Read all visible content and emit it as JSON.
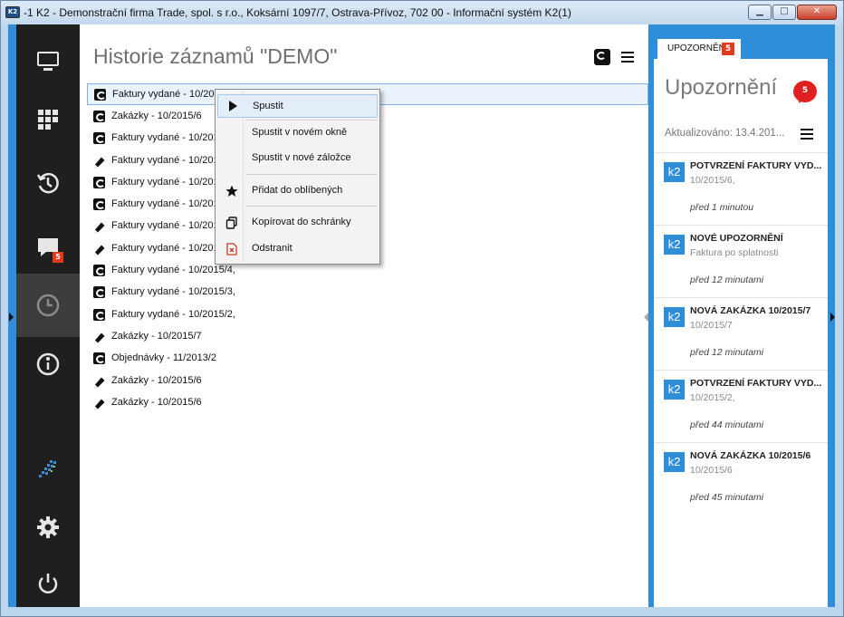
{
  "window": {
    "icon_text": "K2",
    "title": "-1 K2 - Demonstrační firma Trade, spol. s r.o., Koksární 1097/7, Ostrava-Přívoz, 702 00 - Informační systém K2(1)",
    "min_glyph": "▁",
    "max_glyph": "□",
    "close_glyph": "✕"
  },
  "rail": {
    "chat_badge": "5"
  },
  "main": {
    "title": "Historie záznamů \"DEMO\"",
    "history": [
      {
        "label": "Faktury vydané - 10/201",
        "icon": "doc-icon"
      },
      {
        "label": "Zakázky - 10/2015/6",
        "icon": "doc-icon"
      },
      {
        "label": "Faktury vydané - 10/201",
        "icon": "doc-icon"
      },
      {
        "label": "Faktury vydané - 10/201",
        "icon": "pencil-icon"
      },
      {
        "label": "Faktury vydané - 10/201",
        "icon": "doc-icon"
      },
      {
        "label": "Faktury vydané - 10/201",
        "icon": "doc-icon"
      },
      {
        "label": "Faktury vydané - 10/201",
        "icon": "pencil-icon"
      },
      {
        "label": "Faktury vydané - 10/201",
        "icon": "pencil-icon"
      },
      {
        "label": "Faktury vydané - 10/2015/4,",
        "icon": "doc-icon"
      },
      {
        "label": "Faktury vydané - 10/2015/3,",
        "icon": "doc-icon"
      },
      {
        "label": "Faktury vydané - 10/2015/2,",
        "icon": "doc-icon"
      },
      {
        "label": "Zakázky - 10/2015/7",
        "icon": "pencil-icon"
      },
      {
        "label": "Objednávky - 11/2013/2",
        "icon": "doc-icon"
      },
      {
        "label": "Zakázky - 10/2015/6",
        "icon": "pencil-icon"
      },
      {
        "label": "Zakázky - 10/2015/6",
        "icon": "pencil-icon"
      }
    ]
  },
  "context_menu": {
    "run": "Spustit",
    "run_new_window": "Spustit v novém okně",
    "run_new_tab": "Spustit v nové záložce",
    "add_favorites": "Přidat do oblíbených",
    "copy_clipboard": "Kopírovat do schránky",
    "remove": "Odstranit"
  },
  "notifications": {
    "tab_label": "UPOZORNĚNÍ",
    "tab_badge": "5",
    "title": "Upozornění",
    "count": "5",
    "updated": "Aktualizováno: 13.4.201...",
    "items": [
      {
        "icon": "k2",
        "title": "POTVRZENÍ FAKTURY VYD...",
        "subtitle": "10/2015/6,",
        "time": "před 1 minutou"
      },
      {
        "icon": "k2",
        "title": "NOVÉ UPOZORNĚNÍ",
        "subtitle": "Faktura po splatnosti",
        "time": "před 12 minutami"
      },
      {
        "icon": "k2",
        "title": "NOVÁ ZAKÁZKA 10/2015/7",
        "subtitle": "10/2015/7",
        "time": "před 12 minutami"
      },
      {
        "icon": "k2",
        "title": "POTVRZENÍ FAKTURY VYD...",
        "subtitle": "10/2015/2,",
        "time": "před 44 minutami"
      },
      {
        "icon": "k2",
        "title": "NOVÁ ZAKÁZKA 10/2015/6",
        "subtitle": "10/2015/6",
        "time": "před 45 minutami"
      }
    ]
  },
  "colors": {
    "accent": "#2e8fd8",
    "rail": "#1f1f1f",
    "badge": "#e23a1c"
  }
}
